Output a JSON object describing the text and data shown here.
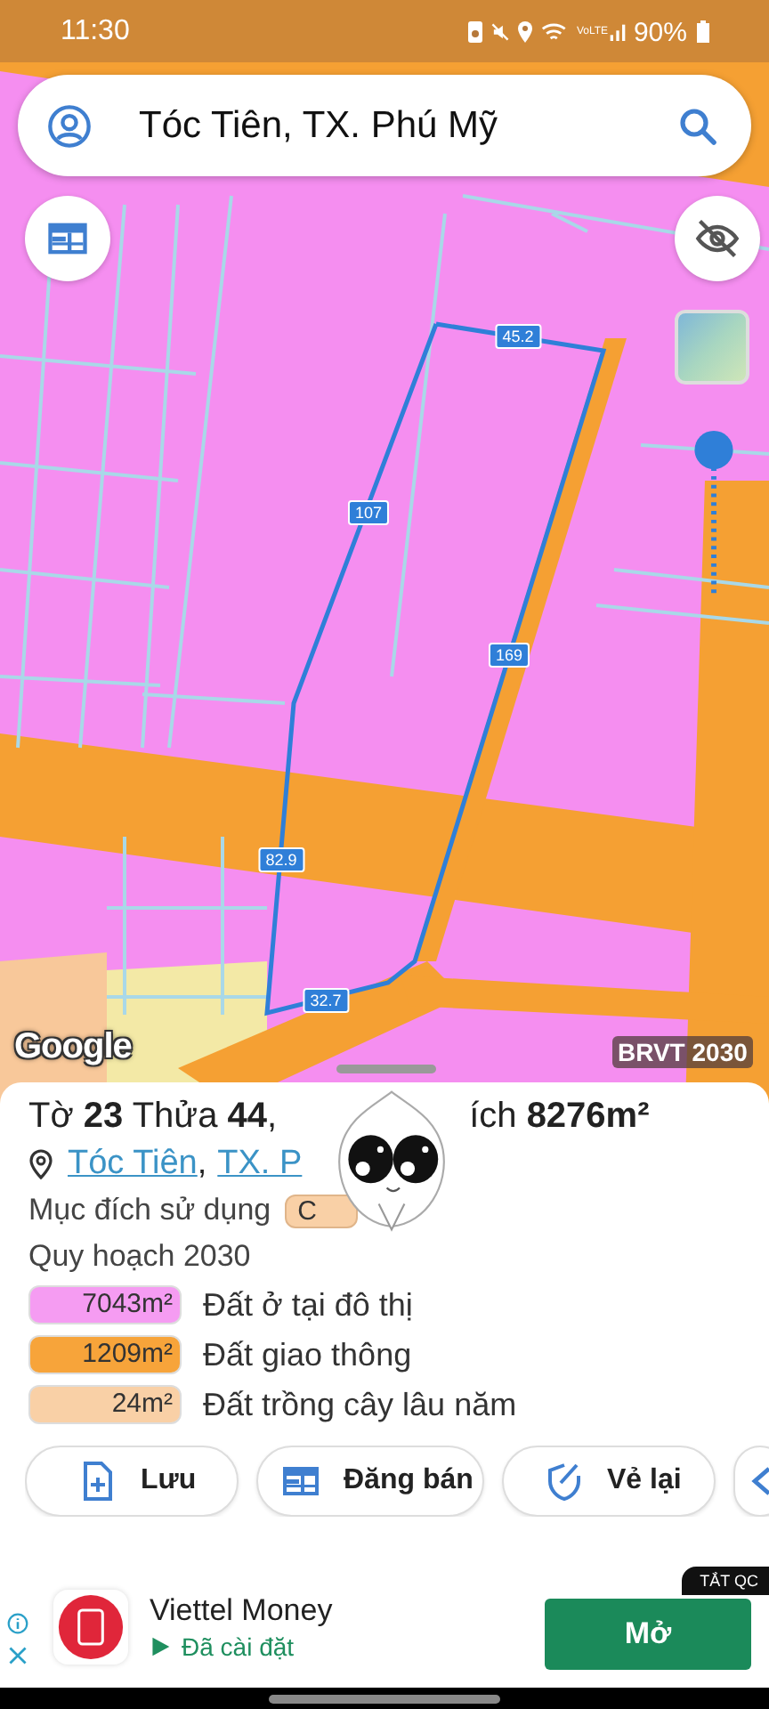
{
  "status_bar": {
    "time": "11:30",
    "network": "VoLTE",
    "battery": "90%"
  },
  "search": {
    "value": "Tóc Tiên, TX. Phú Mỹ"
  },
  "map": {
    "edge_labels": [
      "45.2",
      "107",
      "169",
      "82.9",
      "32.7"
    ],
    "attribution": "Google",
    "layer_badge": "BRVT 2030"
  },
  "parcel": {
    "title_start": "Tờ **23** Thửa **44**,",
    "title_end": "ích **8276m²**",
    "address_links": [
      "Tóc Tiên",
      "TX. P"
    ],
    "address_separator": ",",
    "usage_label": "Mục đích sử dụng",
    "usage_chip": "C",
    "plan_heading": "Quy hoạch 2030",
    "zones": [
      {
        "area": "7043m²",
        "name": "Đất ở tại đô thị",
        "color": "#f59cf2"
      },
      {
        "area": "1209m²",
        "name": "Đất giao thông",
        "color": "#f7a43a"
      },
      {
        "area": "24m²",
        "name": "Đất trồng cây lâu năm",
        "color": "#f9d0a6"
      }
    ]
  },
  "actions": [
    {
      "kind": "save",
      "label": "Lưu"
    },
    {
      "kind": "post",
      "label": "Đăng bán"
    },
    {
      "kind": "redraw",
      "label": "Vẻ lại"
    },
    {
      "kind": "partial"
    }
  ],
  "ad": {
    "app_name": "Viettel Money",
    "status": "Đã cài đặt",
    "button": "Mở",
    "hide_label": "TẮT QC"
  }
}
